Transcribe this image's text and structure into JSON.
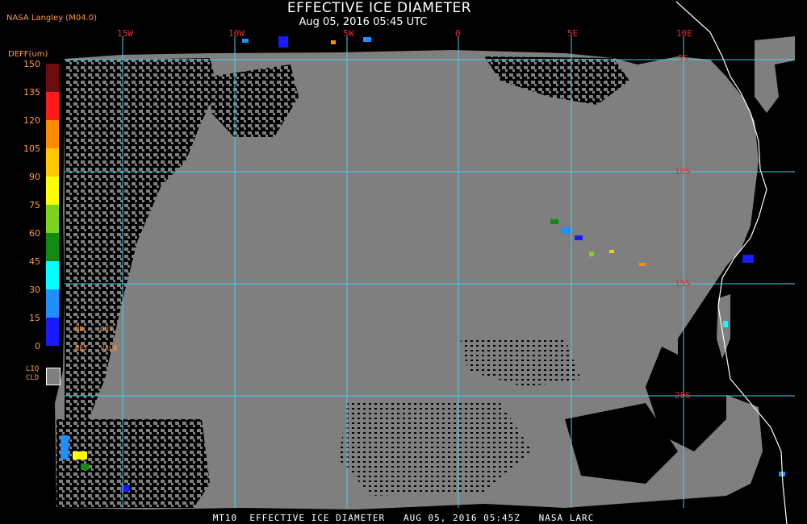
{
  "header": {
    "title": "EFFECTIVE ICE DIAMETER",
    "subtitle": "Aug 05, 2016 05:45 UTC",
    "source": "NASA Langley (M04.0)"
  },
  "map": {
    "lon_labels": [
      "15W",
      "10W",
      "5W",
      "0",
      "5E",
      "10E"
    ],
    "lat_labels": [
      "5S",
      "10S",
      "15S",
      "20S"
    ],
    "colors": {
      "cloud": "#7f7f7f",
      "grid": "#45d0e8",
      "coast": "#ffffff"
    }
  },
  "legend": {
    "title": "DEFF(um)",
    "ticks": [
      "150",
      "135",
      "120",
      "105",
      "90",
      "75",
      "60",
      "45",
      "30",
      "15",
      "0"
    ],
    "colors": [
      "#6b0d0d",
      "#ff1a1a",
      "#ff8c00",
      "#ffc800",
      "#ffff00",
      "#7cd41a",
      "#128a12",
      "#00ffff",
      "#2090ff",
      "#1a1aff",
      "#8a2be2"
    ],
    "no_ret": [
      "NO",
      "RET"
    ],
    "out_valr": [
      "OUT",
      "VALR"
    ],
    "liq_cld": [
      "LIQ",
      "CLD"
    ]
  },
  "footer": "MT10  EFFECTIVE ICE DIAMETER   AUG 05, 2016 05:45Z   NASA LARC"
}
